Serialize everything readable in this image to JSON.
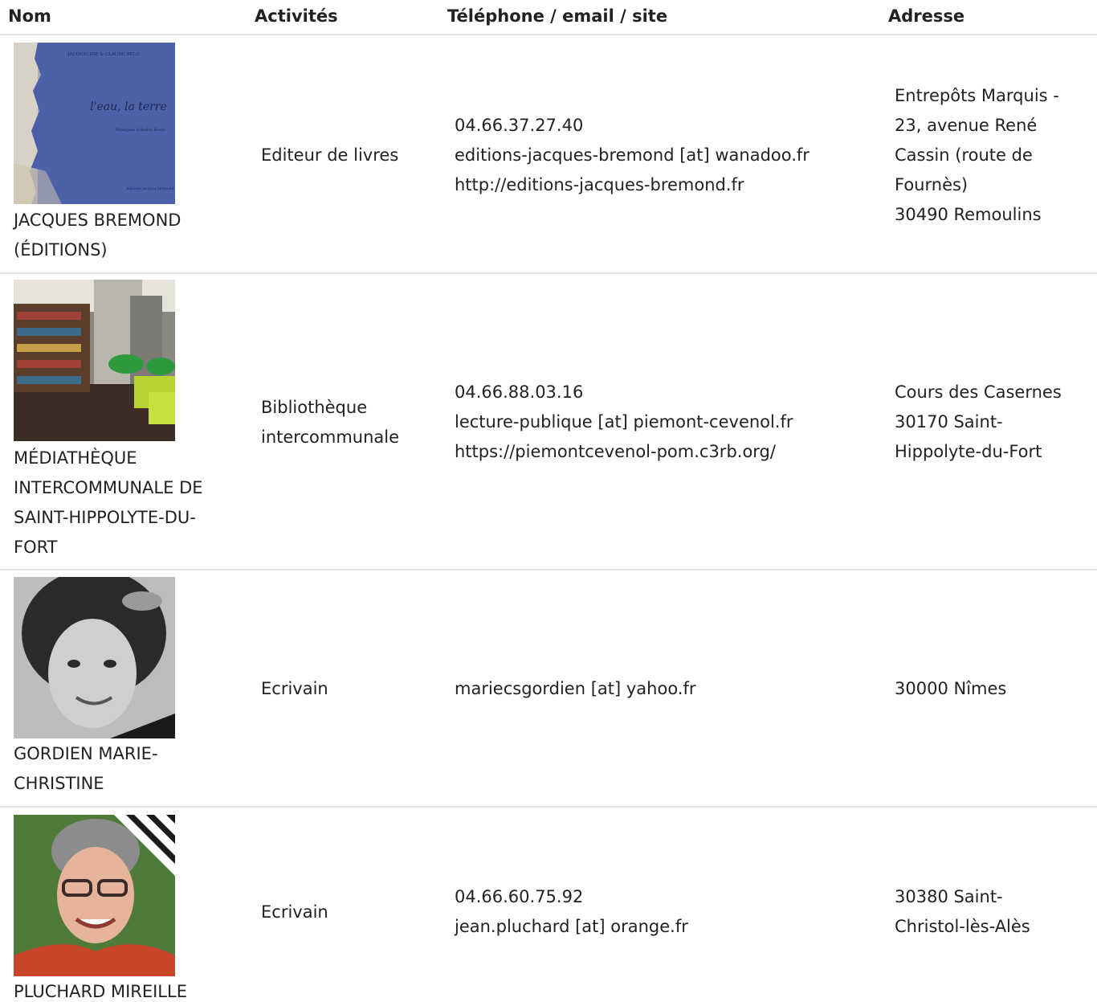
{
  "header": {
    "nom": "Nom",
    "activites": "Activités",
    "contact": "Téléphone / email / site",
    "adresse": "Adresse"
  },
  "rows": [
    {
      "image": "book-cover-image",
      "book_author": "JACQUELINE & CLAUDE BELO",
      "book_title": "l'eau, la terre",
      "book_subtitle": "Musiques d'André Rosso",
      "book_publisher": "éditions jacques bremond",
      "name": "JACQUES BREMOND (ÉDITIONS)",
      "activity": "Editeur de livres",
      "phone": "04.66.37.27.40",
      "email": "editions-jacques-bremond [at] wanadoo.fr",
      "site": "http://editions-jacques-bremond.fr",
      "address_1": "Entrepôts Marquis - 23, avenue René Cassin (route de Fournès)",
      "address_2": "30490 Remoulins"
    },
    {
      "image": "library-interior-photo",
      "name": "MÉDIATHÈQUE INTERCOMMUNALE DE SAINT-HIPPOLYTE-DU-FORT",
      "activity": "Bibliothèque intercommunale",
      "phone": "04.66.88.03.16",
      "email": "lecture-publique [at] piemont-cevenol.fr",
      "site": "https://piemontcevenol-pom.c3rb.org/",
      "address_1": "Cours des Casernes",
      "address_2": "30170 Saint-Hippolyte-du-Fort"
    },
    {
      "image": "portrait-photo-bw",
      "name": "GORDIEN MARIE-CHRISTINE",
      "activity": "Ecrivain",
      "email": "mariecsgordien [at] yahoo.fr",
      "address_2": "30000 Nîmes"
    },
    {
      "image": "portrait-photo-color",
      "name": "PLUCHARD MIREILLE",
      "activity": "Ecrivain",
      "phone": "04.66.60.75.92",
      "email": "jean.pluchard [at] orange.fr",
      "address_2": "30380 Saint-Christol-lès-Alès"
    }
  ]
}
